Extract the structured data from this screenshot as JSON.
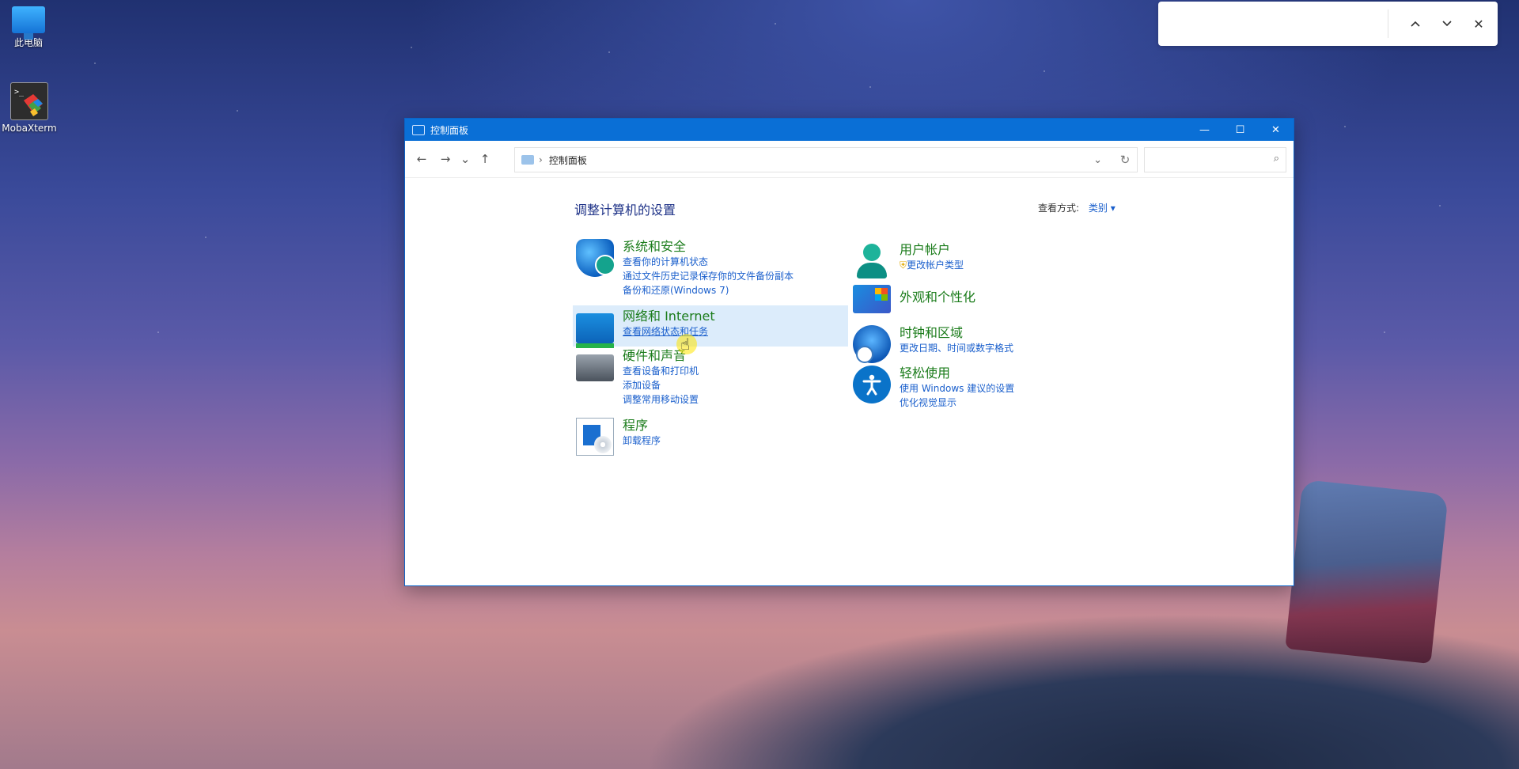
{
  "desktop": {
    "icons": [
      {
        "label": "此电脑",
        "icon": "monitor-icon"
      },
      {
        "label": "MobaXterm",
        "icon": "mobaxterm-icon"
      }
    ]
  },
  "findbar": {
    "up": "^",
    "down": "v",
    "close": "✕"
  },
  "window": {
    "title": "控制面板",
    "controls": {
      "min": "—",
      "max": "☐",
      "close": "✕"
    },
    "nav": {
      "back": "←",
      "forward": "→",
      "recent": "⌄",
      "up": "↑"
    },
    "address": {
      "sep": "›",
      "path": "控制面板",
      "drop": "⌄",
      "refresh": "↻"
    },
    "search": {
      "placeholder": "",
      "icon": "⌕"
    },
    "heading": "调整计算机的设置",
    "view_by": {
      "label": "查看方式:",
      "value": "类别 ▾"
    },
    "categories": [
      {
        "title": "系统和安全",
        "icon": "shield-icon",
        "links": [
          "查看你的计算机状态",
          "通过文件历史记录保存你的文件备份副本",
          "备份和还原(Windows 7)"
        ]
      },
      {
        "title": "网络和 Internet",
        "icon": "network-icon",
        "links": [
          "查看网络状态和任务"
        ],
        "highlighted": true
      },
      {
        "title": "硬件和声音",
        "icon": "printer-icon",
        "links": [
          "查看设备和打印机",
          "添加设备",
          "调整常用移动设置"
        ]
      },
      {
        "title": "程序",
        "icon": "programs-icon",
        "links": [
          "卸载程序"
        ]
      },
      {
        "title": "用户帐户",
        "icon": "user-icon",
        "links": [
          "更改帐户类型"
        ]
      },
      {
        "title": "外观和个性化",
        "icon": "appearance-icon",
        "links": []
      },
      {
        "title": "时钟和区域",
        "icon": "clock-icon",
        "links": [
          "更改日期、时间或数字格式"
        ]
      },
      {
        "title": "轻松使用",
        "icon": "accessibility-icon",
        "links": [
          "使用 Windows 建议的设置",
          "优化视觉显示"
        ]
      }
    ]
  },
  "colors": {
    "title_bar": "#0a6fd6",
    "category_title": "#1b7c1b",
    "link": "#1a5fcc",
    "highlight": "#dcecfb"
  }
}
